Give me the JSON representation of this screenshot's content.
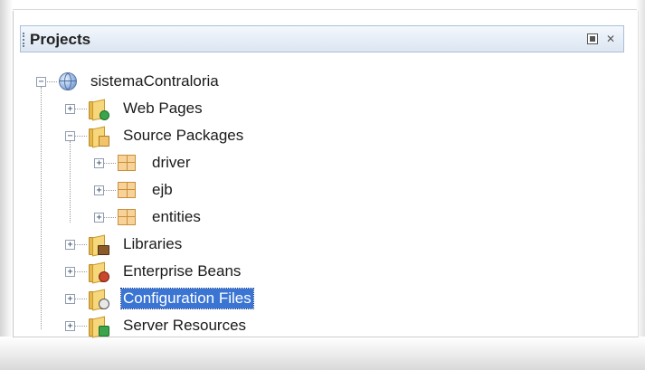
{
  "window": {
    "title": "Projects"
  },
  "tree": {
    "root": {
      "label": "sistemaContraloria",
      "expanded": true,
      "icon": "web-project-globe-icon"
    },
    "items": [
      {
        "label": "Web Pages",
        "icon": "web-pages-folder-icon",
        "expanded": false
      },
      {
        "label": "Source Packages",
        "icon": "source-packages-folder-icon",
        "expanded": true
      },
      {
        "label": "driver",
        "icon": "java-package-icon",
        "expanded": false
      },
      {
        "label": "ejb",
        "icon": "java-package-icon",
        "expanded": false
      },
      {
        "label": "entities",
        "icon": "java-package-icon",
        "expanded": false
      },
      {
        "label": "Libraries",
        "icon": "libraries-folder-icon",
        "expanded": false
      },
      {
        "label": "Enterprise Beans",
        "icon": "enterprise-beans-folder-icon",
        "expanded": false
      },
      {
        "label": "Configuration Files",
        "icon": "configuration-files-folder-icon",
        "expanded": false,
        "selected": true
      },
      {
        "label": "Server Resources",
        "icon": "server-resources-folder-icon",
        "expanded": false
      }
    ]
  },
  "colors": {
    "selection": "#3b75d4",
    "header_border": "#a9bfd6"
  }
}
